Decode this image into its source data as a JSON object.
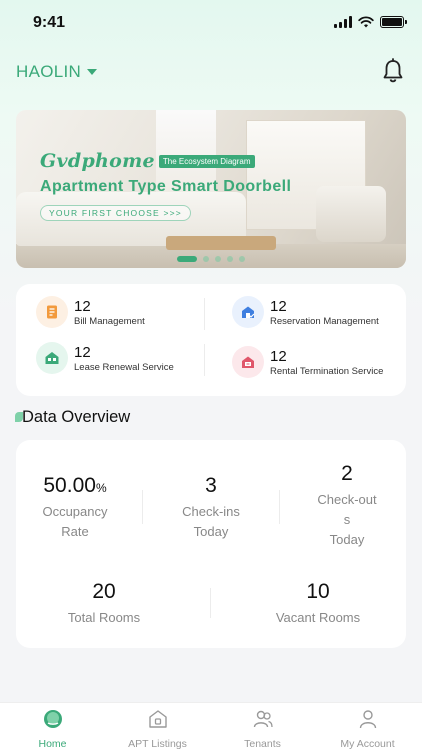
{
  "status_bar": {
    "time": "9:41"
  },
  "header": {
    "location": "HAOLIN"
  },
  "banner": {
    "brand": "Gvdphome",
    "tag": "The Ecosystem Diagram",
    "title": "Apartment Type Smart Doorbell",
    "cta": "YOUR FIRST CHOOSE >>>",
    "slides": 5,
    "active_slide": 1
  },
  "services": [
    {
      "count": "12",
      "label": "Bill Management",
      "icon": "bill-icon",
      "color": "#f29a3d",
      "bg": "#fdf0e3"
    },
    {
      "count": "12",
      "label": "Reservation Management",
      "icon": "reservation-icon",
      "color": "#3f7fe0",
      "bg": "#e9f1fd"
    },
    {
      "count": "12",
      "label": "Lease Renewal Service",
      "icon": "lease-icon",
      "color": "#3ba979",
      "bg": "#e5f6ee"
    },
    {
      "count": "12",
      "label": "Rental Termination Service",
      "icon": "termination-icon",
      "color": "#e0566a",
      "bg": "#fce8eb"
    }
  ],
  "overview": {
    "title": "Data Overview",
    "occupancy": {
      "value": "50.00",
      "unit": "%",
      "label1": "Occupancy",
      "label2": "Rate"
    },
    "checkins": {
      "value": "3",
      "label1": "Check-ins",
      "label2": "Today"
    },
    "checkouts": {
      "value": "2",
      "label1": "Check-out",
      "label2": "s",
      "label3": "Today"
    },
    "total_rooms": {
      "value": "20",
      "label": "Total Rooms"
    },
    "vacant_rooms": {
      "value": "10",
      "label": "Vacant Rooms"
    }
  },
  "tabs": [
    {
      "label": "Home",
      "icon": "home-icon",
      "active": true
    },
    {
      "label": "APT Listings",
      "icon": "listings-icon",
      "active": false
    },
    {
      "label": "Tenants",
      "icon": "tenants-icon",
      "active": false
    },
    {
      "label": "My Account",
      "icon": "account-icon",
      "active": false
    }
  ],
  "colors": {
    "accent": "#3ba979",
    "background": "#f4f5f7"
  }
}
